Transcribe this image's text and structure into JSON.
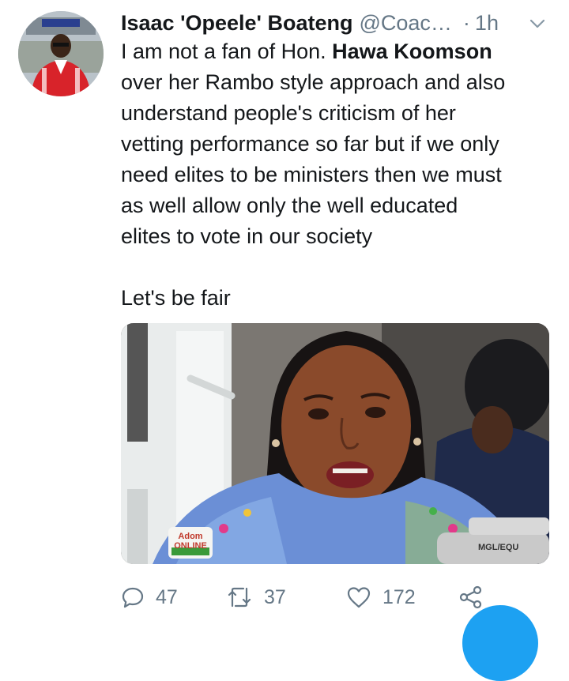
{
  "tweet": {
    "display_name": "Isaac 'Opeele' Boateng",
    "handle": "@Coac…",
    "separator": "·",
    "time": "1h",
    "avatar_icon": "profile-photo",
    "body_lines": [
      {
        "pre": "I am not a fan of Hon. ",
        "bold": "Hawa Koomson",
        "post": ""
      },
      {
        "pre": "over her Rambo style approach and also",
        "bold": "",
        "post": ""
      },
      {
        "pre": "understand people's criticism of her",
        "bold": "",
        "post": ""
      },
      {
        "pre": "vetting performance so far but if we only",
        "bold": "",
        "post": ""
      },
      {
        "pre": "need elites to be ministers then we must",
        "bold": "",
        "post": ""
      },
      {
        "pre": "as well allow only the well educated",
        "bold": "",
        "post": ""
      },
      {
        "pre": "elites to vote in our society",
        "bold": "",
        "post": ""
      }
    ],
    "closing_line": "Let's be fair",
    "media": {
      "watermark": "Adom ONLINE",
      "mic_label": "MGL/EQU"
    }
  },
  "actions": {
    "reply_count": "47",
    "retweet_count": "37",
    "like_count": "172"
  },
  "colors": {
    "text": "#14171a",
    "secondary": "#657786",
    "accent": "#1da1f2"
  }
}
